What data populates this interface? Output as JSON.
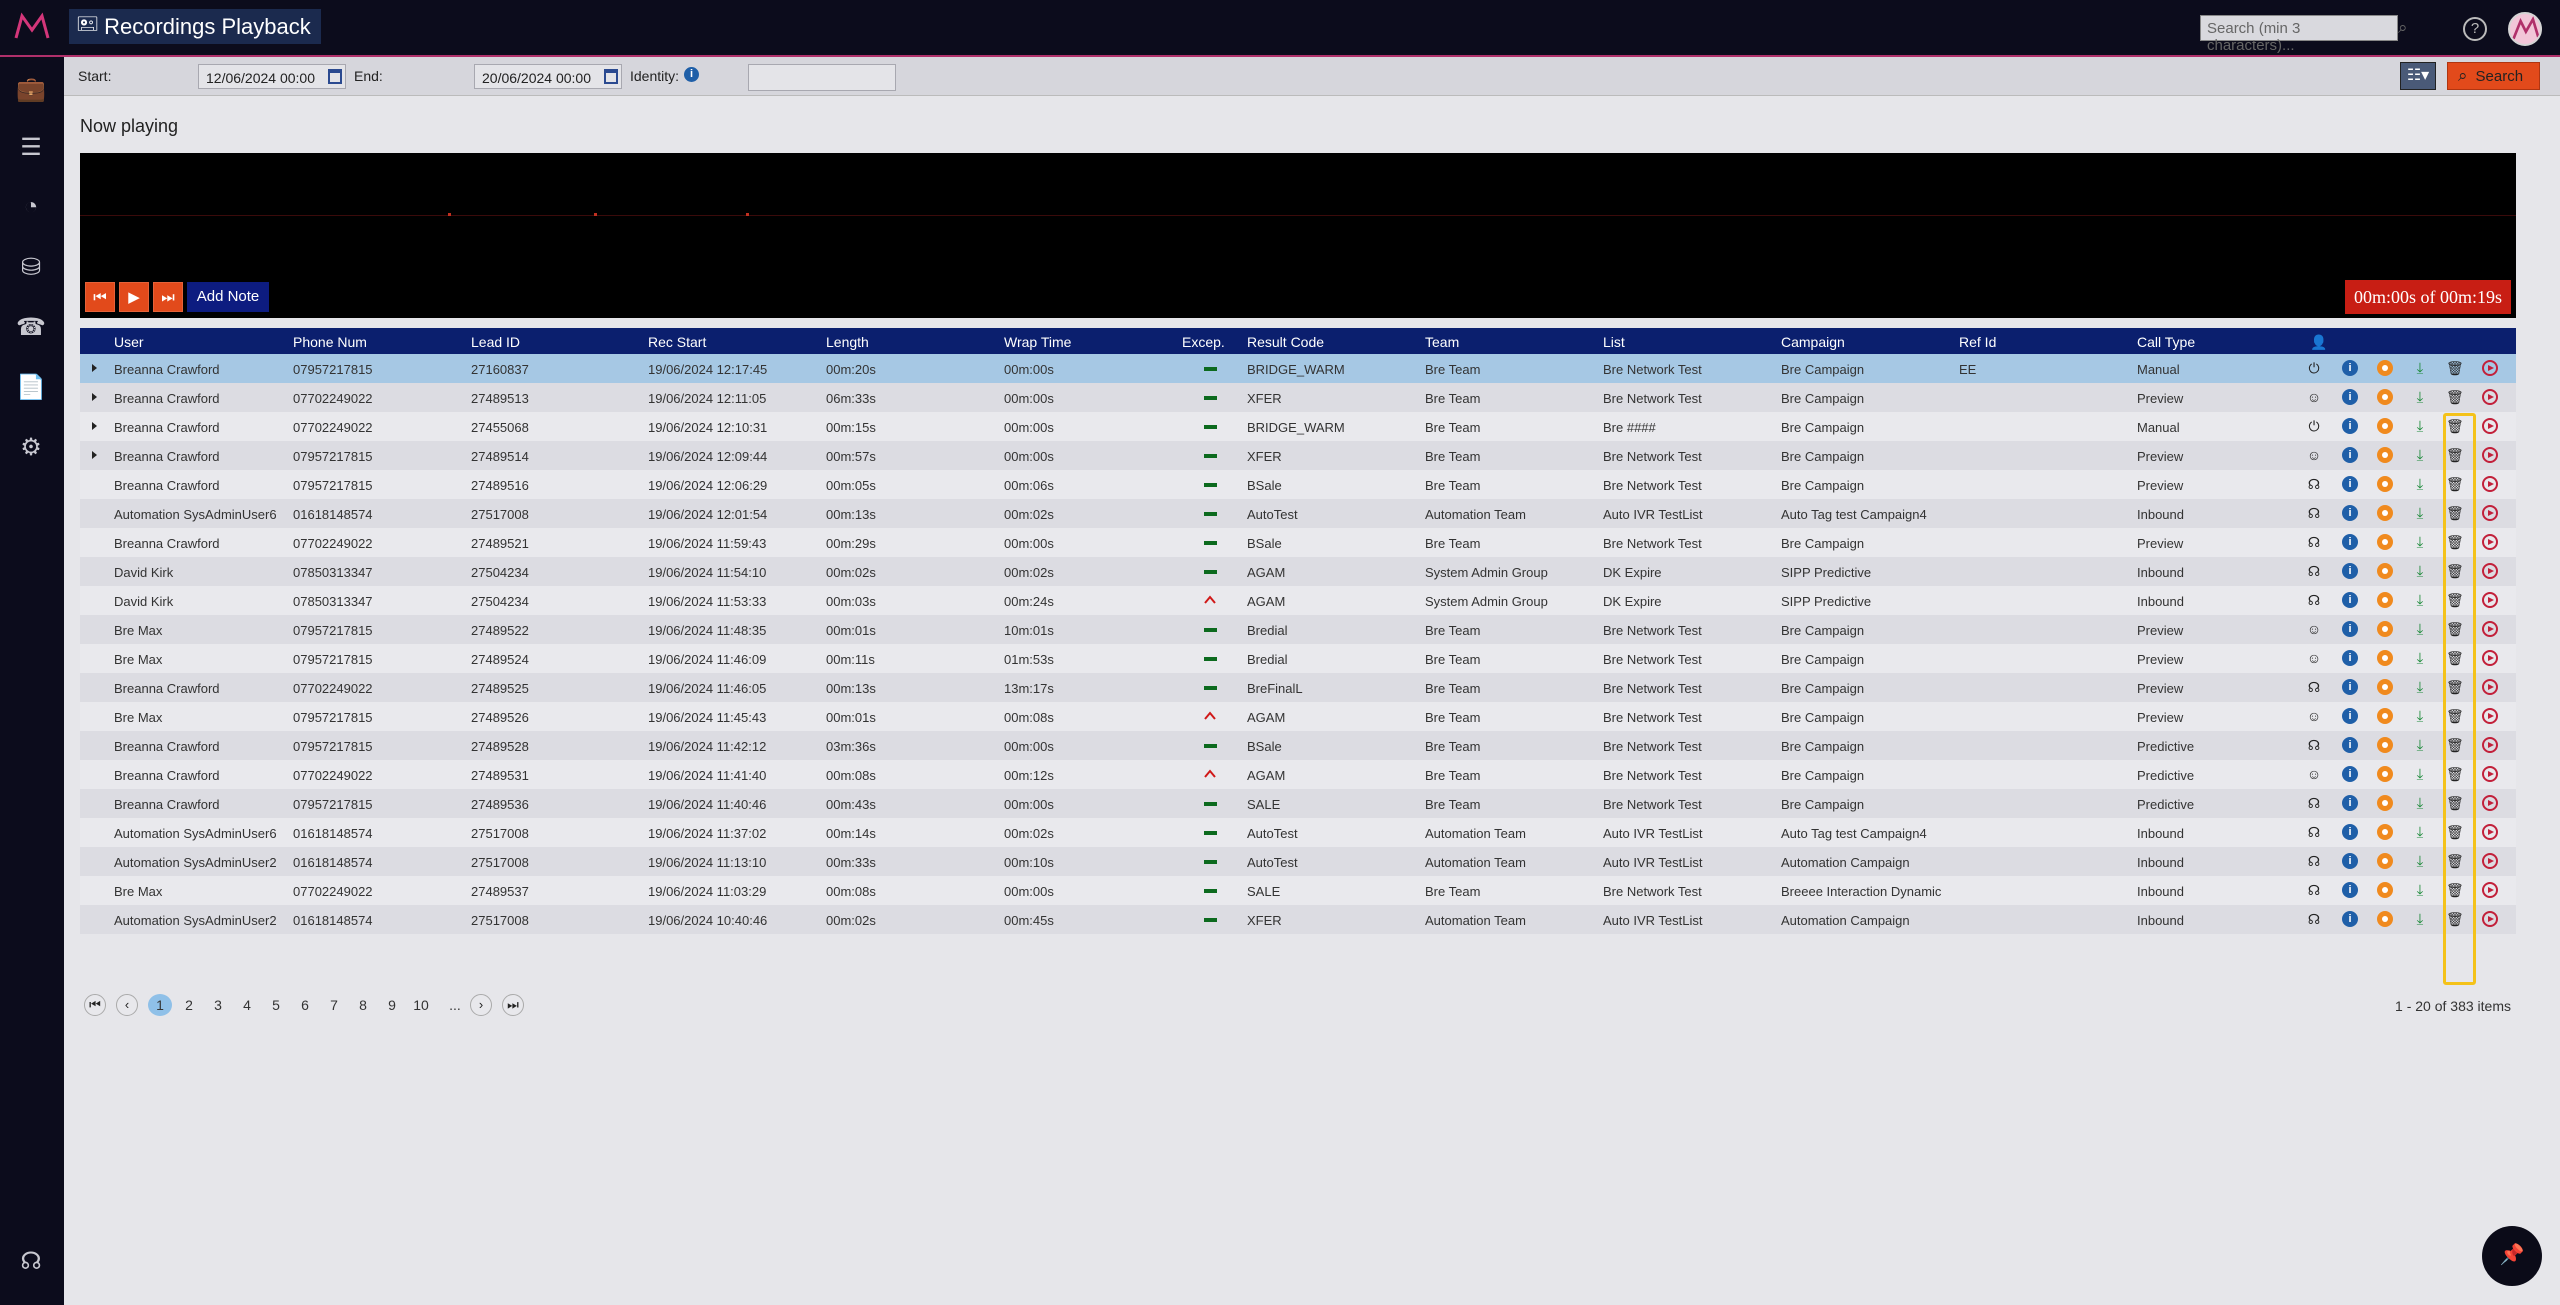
{
  "app": {
    "title": "Recordings Playback",
    "title_icon": "voicemail-icon"
  },
  "topbar": {
    "search_placeholder": "Search (min 3 characters)..."
  },
  "filters": {
    "start_label": "Start:",
    "start_value": "12/06/2024 00:00",
    "end_label": "End:",
    "end_value": "20/06/2024 00:00",
    "identity_label": "Identity:",
    "search_label": "Search"
  },
  "player": {
    "heading": "Now playing",
    "add_note_label": "Add Note",
    "timer": "00m:00s of 00m:19s"
  },
  "table": {
    "columns": [
      "User",
      "Phone Num",
      "Lead ID",
      "Rec Start",
      "Length",
      "Wrap Time",
      "Excep.",
      "Result Code",
      "Team",
      "List",
      "Campaign",
      "Ref Id",
      "Call Type"
    ],
    "rows": [
      {
        "user": "Breanna Crawford",
        "phone": "07957217815",
        "lead": "27160837",
        "start": "19/06/2024 12:17:45",
        "length": "00m:20s",
        "wrap": "00m:00s",
        "exc": "ok",
        "result": "BRIDGE_WARM",
        "team": "Bre Team",
        "list": "Bre Network Test",
        "campaign": "Bre Campaign",
        "ref": "EE",
        "type": "Manual",
        "icon": "power",
        "expand": true
      },
      {
        "user": "Breanna Crawford",
        "phone": "07702249022",
        "lead": "27489513",
        "start": "19/06/2024 12:11:05",
        "length": "06m:33s",
        "wrap": "00m:00s",
        "exc": "ok",
        "result": "XFER",
        "team": "Bre Team",
        "list": "Bre Network Test",
        "campaign": "Bre Campaign",
        "ref": "",
        "type": "Preview",
        "icon": "person",
        "expand": true
      },
      {
        "user": "Breanna Crawford",
        "phone": "07702249022",
        "lead": "27455068",
        "start": "19/06/2024 12:10:31",
        "length": "00m:15s",
        "wrap": "00m:00s",
        "exc": "ok",
        "result": "BRIDGE_WARM",
        "team": "Bre Team",
        "list": "Bre ####",
        "campaign": "Bre Campaign",
        "ref": "",
        "type": "Manual",
        "icon": "power",
        "expand": true
      },
      {
        "user": "Breanna Crawford",
        "phone": "07957217815",
        "lead": "27489514",
        "start": "19/06/2024 12:09:44",
        "length": "00m:57s",
        "wrap": "00m:00s",
        "exc": "ok",
        "result": "XFER",
        "team": "Bre Team",
        "list": "Bre Network Test",
        "campaign": "Bre Campaign",
        "ref": "",
        "type": "Preview",
        "icon": "person",
        "expand": true
      },
      {
        "user": "Breanna Crawford",
        "phone": "07957217815",
        "lead": "27489516",
        "start": "19/06/2024 12:06:29",
        "length": "00m:05s",
        "wrap": "00m:06s",
        "exc": "ok",
        "result": "BSale",
        "team": "Bre Team",
        "list": "Bre Network Test",
        "campaign": "Bre Campaign",
        "ref": "",
        "type": "Preview",
        "icon": "headset",
        "expand": false
      },
      {
        "user": "Automation SysAdminUser6",
        "phone": "01618148574",
        "lead": "27517008",
        "start": "19/06/2024 12:01:54",
        "length": "00m:13s",
        "wrap": "00m:02s",
        "exc": "ok",
        "result": "AutoTest",
        "team": "Automation Team",
        "list": "Auto IVR TestList",
        "campaign": "Auto Tag test Campaign4",
        "ref": "",
        "type": "Inbound",
        "icon": "headset",
        "expand": false
      },
      {
        "user": "Breanna Crawford",
        "phone": "07702249022",
        "lead": "27489521",
        "start": "19/06/2024 11:59:43",
        "length": "00m:29s",
        "wrap": "00m:00s",
        "exc": "ok",
        "result": "BSale",
        "team": "Bre Team",
        "list": "Bre Network Test",
        "campaign": "Bre Campaign",
        "ref": "",
        "type": "Preview",
        "icon": "headset",
        "expand": false
      },
      {
        "user": "David Kirk",
        "phone": "07850313347",
        "lead": "27504234",
        "start": "19/06/2024 11:54:10",
        "length": "00m:02s",
        "wrap": "00m:02s",
        "exc": "ok",
        "result": "AGAM",
        "team": "System Admin Group",
        "list": "DK Expire",
        "campaign": "SIPP Predictive",
        "ref": "",
        "type": "Inbound",
        "icon": "headset",
        "expand": false
      },
      {
        "user": "David Kirk",
        "phone": "07850313347",
        "lead": "27504234",
        "start": "19/06/2024 11:53:33",
        "length": "00m:03s",
        "wrap": "00m:24s",
        "exc": "warn",
        "result": "AGAM",
        "team": "System Admin Group",
        "list": "DK Expire",
        "campaign": "SIPP Predictive",
        "ref": "",
        "type": "Inbound",
        "icon": "headset",
        "expand": false
      },
      {
        "user": "Bre Max",
        "phone": "07957217815",
        "lead": "27489522",
        "start": "19/06/2024 11:48:35",
        "length": "00m:01s",
        "wrap": "10m:01s",
        "exc": "ok",
        "result": "Bredial",
        "team": "Bre Team",
        "list": "Bre Network Test",
        "campaign": "Bre Campaign",
        "ref": "",
        "type": "Preview",
        "icon": "person",
        "expand": false
      },
      {
        "user": "Bre Max",
        "phone": "07957217815",
        "lead": "27489524",
        "start": "19/06/2024 11:46:09",
        "length": "00m:11s",
        "wrap": "01m:53s",
        "exc": "ok",
        "result": "Bredial",
        "team": "Bre Team",
        "list": "Bre Network Test",
        "campaign": "Bre Campaign",
        "ref": "",
        "type": "Preview",
        "icon": "person",
        "expand": false
      },
      {
        "user": "Breanna Crawford",
        "phone": "07702249022",
        "lead": "27489525",
        "start": "19/06/2024 11:46:05",
        "length": "00m:13s",
        "wrap": "13m:17s",
        "exc": "ok",
        "result": "BreFinalL",
        "team": "Bre Team",
        "list": "Bre Network Test",
        "campaign": "Bre Campaign",
        "ref": "",
        "type": "Preview",
        "icon": "headset",
        "expand": false
      },
      {
        "user": "Bre Max",
        "phone": "07957217815",
        "lead": "27489526",
        "start": "19/06/2024 11:45:43",
        "length": "00m:01s",
        "wrap": "00m:08s",
        "exc": "warn",
        "result": "AGAM",
        "team": "Bre Team",
        "list": "Bre Network Test",
        "campaign": "Bre Campaign",
        "ref": "",
        "type": "Preview",
        "icon": "person",
        "expand": false
      },
      {
        "user": "Breanna Crawford",
        "phone": "07957217815",
        "lead": "27489528",
        "start": "19/06/2024 11:42:12",
        "length": "03m:36s",
        "wrap": "00m:00s",
        "exc": "ok",
        "result": "BSale",
        "team": "Bre Team",
        "list": "Bre Network Test",
        "campaign": "Bre Campaign",
        "ref": "",
        "type": "Predictive",
        "icon": "headset",
        "expand": false
      },
      {
        "user": "Breanna Crawford",
        "phone": "07702249022",
        "lead": "27489531",
        "start": "19/06/2024 11:41:40",
        "length": "00m:08s",
        "wrap": "00m:12s",
        "exc": "warn",
        "result": "AGAM",
        "team": "Bre Team",
        "list": "Bre Network Test",
        "campaign": "Bre Campaign",
        "ref": "",
        "type": "Predictive",
        "icon": "person",
        "expand": false
      },
      {
        "user": "Breanna Crawford",
        "phone": "07957217815",
        "lead": "27489536",
        "start": "19/06/2024 11:40:46",
        "length": "00m:43s",
        "wrap": "00m:00s",
        "exc": "ok",
        "result": "SALE",
        "team": "Bre Team",
        "list": "Bre Network Test",
        "campaign": "Bre Campaign",
        "ref": "",
        "type": "Predictive",
        "icon": "headset",
        "expand": false
      },
      {
        "user": "Automation SysAdminUser6",
        "phone": "01618148574",
        "lead": "27517008",
        "start": "19/06/2024 11:37:02",
        "length": "00m:14s",
        "wrap": "00m:02s",
        "exc": "ok",
        "result": "AutoTest",
        "team": "Automation Team",
        "list": "Auto IVR TestList",
        "campaign": "Auto Tag test Campaign4",
        "ref": "",
        "type": "Inbound",
        "icon": "headset",
        "expand": false
      },
      {
        "user": "Automation SysAdminUser2",
        "phone": "01618148574",
        "lead": "27517008",
        "start": "19/06/2024 11:13:10",
        "length": "00m:33s",
        "wrap": "00m:10s",
        "exc": "ok",
        "result": "AutoTest",
        "team": "Automation Team",
        "list": "Auto IVR TestList",
        "campaign": "Automation Campaign",
        "ref": "",
        "type": "Inbound",
        "icon": "headset",
        "expand": false
      },
      {
        "user": "Bre Max",
        "phone": "07702249022",
        "lead": "27489537",
        "start": "19/06/2024 11:03:29",
        "length": "00m:08s",
        "wrap": "00m:00s",
        "exc": "ok",
        "result": "SALE",
        "team": "Bre Team",
        "list": "Bre Network Test",
        "campaign": "Breeee Interaction Dynamic",
        "ref": "",
        "type": "Inbound",
        "icon": "headset",
        "expand": false
      },
      {
        "user": "Automation SysAdminUser2",
        "phone": "01618148574",
        "lead": "27517008",
        "start": "19/06/2024 10:40:46",
        "length": "00m:02s",
        "wrap": "00m:45s",
        "exc": "ok",
        "result": "XFER",
        "team": "Automation Team",
        "list": "Auto IVR TestList",
        "campaign": "Automation Campaign",
        "ref": "",
        "type": "Inbound",
        "icon": "headset",
        "expand": false
      }
    ]
  },
  "pager": {
    "pages": [
      "1",
      "2",
      "3",
      "4",
      "5",
      "6",
      "7",
      "8",
      "9",
      "10",
      "..."
    ],
    "current": "1",
    "info": "1 - 20 of 383 items"
  },
  "colors": {
    "header_bg": "#0b1f6e",
    "accent": "#e24a1b",
    "selected_row": "#a6c8e4",
    "highlight": "#f4c21a"
  }
}
